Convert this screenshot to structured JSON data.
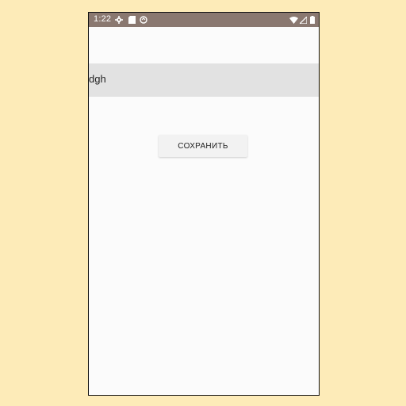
{
  "status_bar": {
    "time": "1:22",
    "left_icons": [
      "settings-icon",
      "sd-card-icon",
      "sync-icon"
    ],
    "right_icons": [
      "wifi-icon",
      "signal-icon",
      "battery-icon"
    ],
    "background": "#8a7870"
  },
  "form": {
    "input_value": "dgh",
    "save_label": "СОХРАНИТЬ"
  },
  "colors": {
    "page_background": "#fdebb8",
    "screen_background": "#fbfbfb",
    "input_background": "#e2e2e2",
    "button_background": "#f2f2f2"
  }
}
